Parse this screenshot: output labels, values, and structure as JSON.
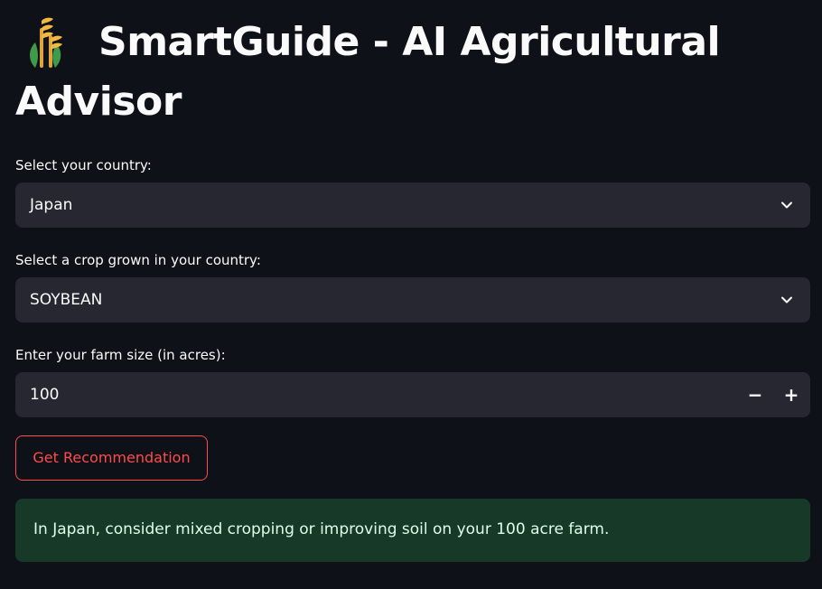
{
  "app": {
    "title": "SmartGuide - AI Agricultural Advisor",
    "logo_icon": "wheat-icon"
  },
  "country_select": {
    "label": "Select your country:",
    "value": "Japan"
  },
  "crop_select": {
    "label": "Select a crop grown in your country:",
    "value": "SOYBEAN"
  },
  "farm_size": {
    "label": "Enter your farm size (in acres):",
    "value": "100",
    "decrement": "−",
    "increment": "+"
  },
  "recommend_button": {
    "label": "Get Recommendation"
  },
  "result": {
    "message": "In Japan, consider mixed cropping or improving soil on your 100 acre farm."
  },
  "colors": {
    "background": "#0e1117",
    "input_background": "#262730",
    "accent": "#ff4b4b",
    "success_background": "#173928",
    "success_text": "#dffde9"
  }
}
